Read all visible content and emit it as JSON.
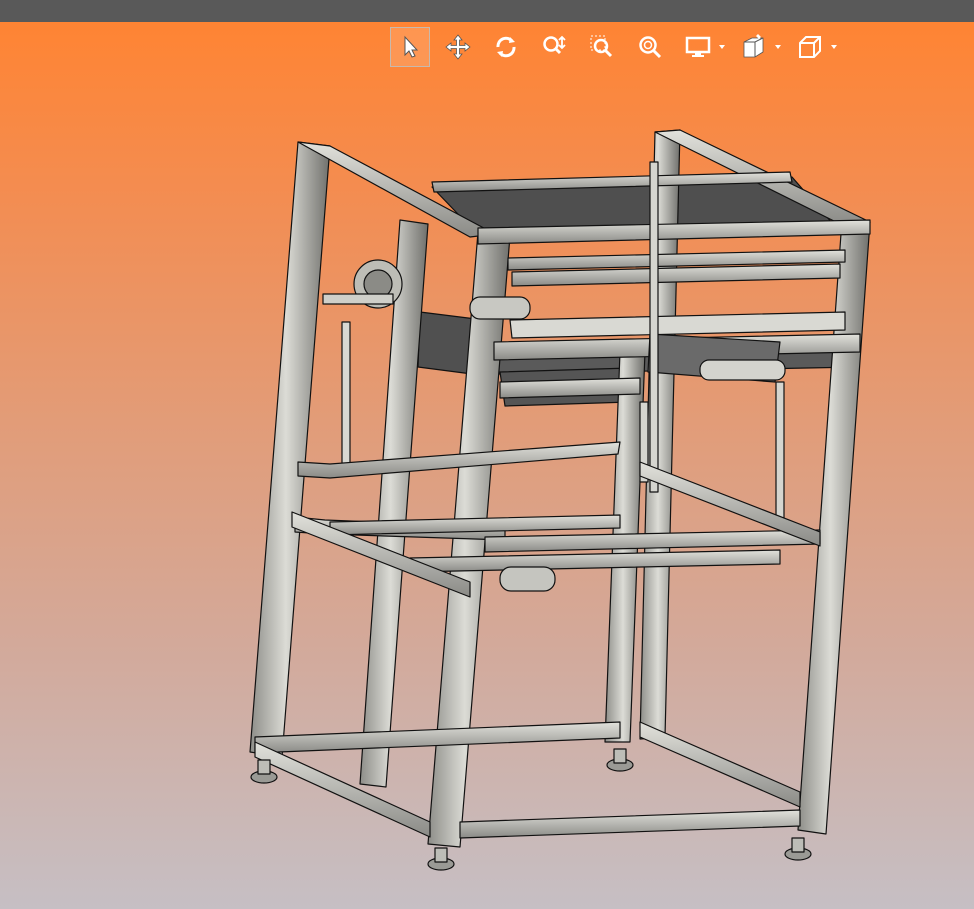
{
  "window": {
    "titlebar_color": "#595959"
  },
  "viewport": {
    "background_top": "#ff8433",
    "background_bottom": "#c6bfc4"
  },
  "toolbar": {
    "tools": [
      {
        "name": "select-tool",
        "icon": "arrow-pointer-icon",
        "active": true
      },
      {
        "name": "pan-tool",
        "icon": "four-arrows-move-icon",
        "active": false
      },
      {
        "name": "rotate-tool",
        "icon": "rotate-icon",
        "active": false
      },
      {
        "name": "zoom-dynamic-tool",
        "icon": "zoom-updown-icon",
        "active": false
      },
      {
        "name": "zoom-window-tool",
        "icon": "zoom-window-icon",
        "active": false
      },
      {
        "name": "zoom-fit-tool",
        "icon": "zoom-fit-icon",
        "active": false
      },
      {
        "name": "display-mode-tool",
        "icon": "monitor-icon",
        "active": false,
        "has_dropdown": true
      },
      {
        "name": "section-view-tool",
        "icon": "section-cube-icon",
        "active": false,
        "has_dropdown": true
      },
      {
        "name": "standard-views-tool",
        "icon": "cube-icon",
        "active": false,
        "has_dropdown": true
      }
    ]
  },
  "model": {
    "description_icon": "3d-assembly-frame",
    "frame_color": "#c9c9c4",
    "edge_color": "#111111"
  }
}
